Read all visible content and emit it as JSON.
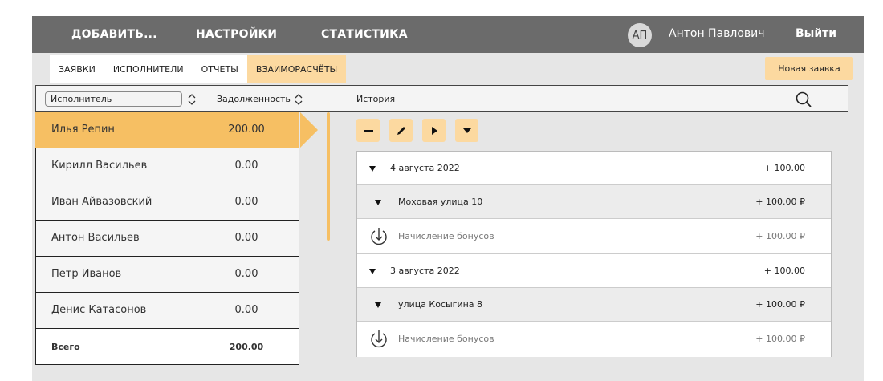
{
  "nav": {
    "items": [
      "ДОБАВИТЬ...",
      "НАСТРОЙКИ",
      "СТАТИСТИКА"
    ],
    "avatar_initials": "АП",
    "user_name": "Антон Павлович",
    "logout_label": "Выйти"
  },
  "tabs": {
    "items": [
      "ЗАЯВКИ",
      "ИСПОЛНИТЕЛИ",
      "ОТЧЕТЫ",
      "ВЗАИМОРАСЧЁТЫ"
    ],
    "active": "ВЗАИМОРАСЧЁТЫ",
    "new_request_label": "Новая заявка"
  },
  "header": {
    "executor_select_value": "Исполнитель",
    "debt_label": "Задолженность",
    "history_label": "История"
  },
  "executors": [
    {
      "name": "Илья Репин",
      "debt": "200.00",
      "selected": true
    },
    {
      "name": "Кирилл Васильев",
      "debt": "0.00"
    },
    {
      "name": "Иван Айвазовский",
      "debt": "0.00"
    },
    {
      "name": "Антон Васильев",
      "debt": "0.00"
    },
    {
      "name": "Петр Иванов",
      "debt": "0.00"
    },
    {
      "name": "Денис Катасонов",
      "debt": "0.00"
    }
  ],
  "total": {
    "label": "Всего",
    "value": "200.00"
  },
  "toolbar": {
    "buttons": [
      "minus-icon",
      "pencil-icon",
      "play-icon",
      "caret-down-icon"
    ]
  },
  "history": [
    {
      "kind": "date",
      "label": "4 августа 2022",
      "amount": "+ 100.00"
    },
    {
      "kind": "addr",
      "label": "Моховая улица 10",
      "amount": "+ 100.00 ₽"
    },
    {
      "kind": "item",
      "label": "Начисление бонусов",
      "amount": "+ 100.00 ₽"
    },
    {
      "kind": "date",
      "label": "3 августа 2022",
      "amount": "+ 100.00"
    },
    {
      "kind": "addr",
      "label": "улица Косыгина 8",
      "amount": "+ 100.00 ₽"
    },
    {
      "kind": "item",
      "label": "Начисление бонусов",
      "amount": "+ 100.00 ₽"
    }
  ],
  "colors": {
    "topbar": "#6b6b6b",
    "accent": "#f6bf63",
    "accent_light": "#fcd9a0",
    "background": "#e6e6e6"
  }
}
